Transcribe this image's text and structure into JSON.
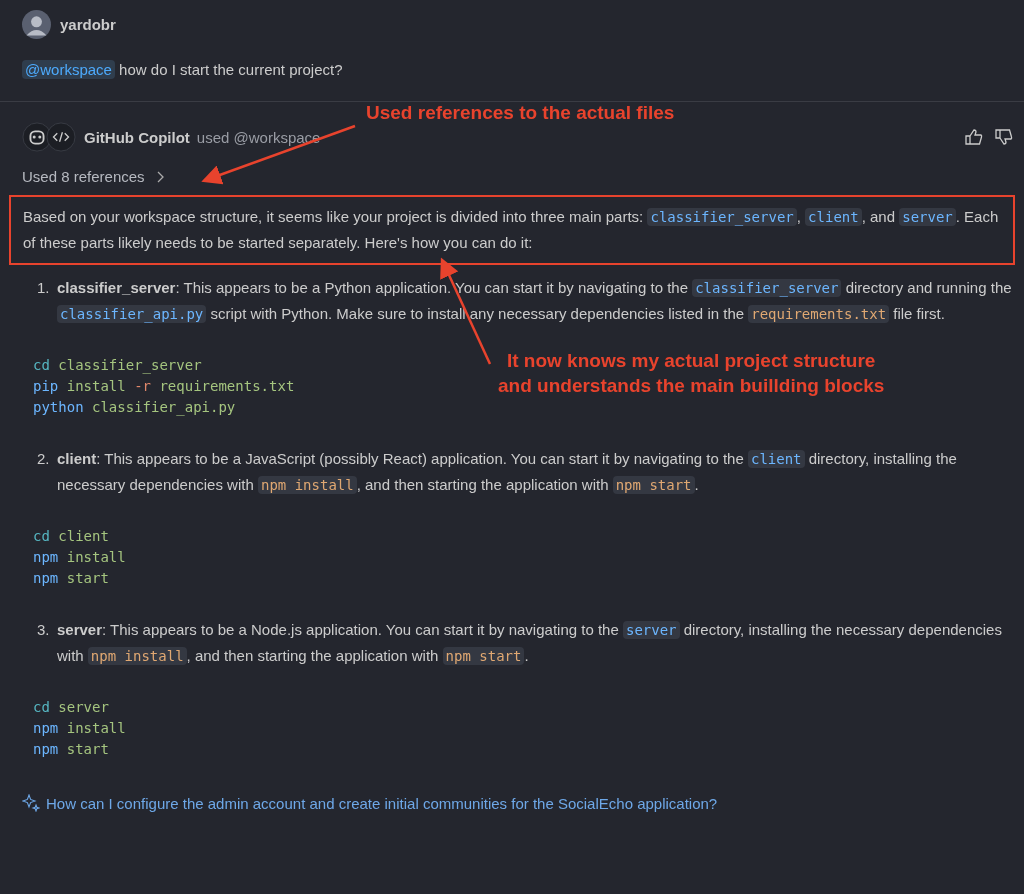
{
  "user": {
    "name": "yardobr"
  },
  "prompt": {
    "mention": "@workspace",
    "text": "how do I start the current project?"
  },
  "response": {
    "author": "GitHub Copilot",
    "used": "used @workspace",
    "references": "Used 8 references",
    "intro": {
      "highlighted": true,
      "segments": [
        {
          "kind": "text",
          "text": "Based on your workspace structure, it seems like your project is divided into three main parts: "
        },
        {
          "kind": "path",
          "text": "classifier_server"
        },
        {
          "kind": "text",
          "text": ", "
        },
        {
          "kind": "path",
          "text": "client"
        },
        {
          "kind": "text",
          "text": ", and "
        },
        {
          "kind": "path",
          "text": "server"
        },
        {
          "kind": "text",
          "text": ". Each of these parts likely needs to be started separately. Here's how you can do it:"
        }
      ]
    },
    "steps": [
      {
        "number": "1.",
        "segments": [
          {
            "kind": "bold",
            "text": "classifier_server"
          },
          {
            "kind": "text",
            "text": ": This appears to be a Python application. You can start it by navigating to the "
          },
          {
            "kind": "path",
            "text": "classifier_server"
          },
          {
            "kind": "text",
            "text": " directory and running the "
          },
          {
            "kind": "path",
            "text": "classifier_api.py"
          },
          {
            "kind": "text",
            "text": " script with Python. Make sure to install any necessary dependencies listed in the "
          },
          {
            "kind": "literal",
            "text": "requirements.txt"
          },
          {
            "kind": "text",
            "text": " file first."
          }
        ],
        "code": [
          [
            {
              "kind": "builtin",
              "text": "cd"
            },
            {
              "kind": "arg",
              "text": " classifier_server"
            }
          ],
          [
            {
              "kind": "command",
              "text": "pip"
            },
            {
              "kind": "arg",
              "text": " install "
            },
            {
              "kind": "flag",
              "text": "-r"
            },
            {
              "kind": "arg",
              "text": " requirements.txt"
            }
          ],
          [
            {
              "kind": "command",
              "text": "python"
            },
            {
              "kind": "arg",
              "text": " classifier_api.py"
            }
          ]
        ]
      },
      {
        "number": "2.",
        "segments": [
          {
            "kind": "bold",
            "text": "client"
          },
          {
            "kind": "text",
            "text": ": This appears to be a JavaScript (possibly React) application. You can start it by navigating to the "
          },
          {
            "kind": "path",
            "text": "client"
          },
          {
            "kind": "text",
            "text": " directory, installing the necessary dependencies with "
          },
          {
            "kind": "literal",
            "text": "npm install"
          },
          {
            "kind": "text",
            "text": ", and then starting the application with "
          },
          {
            "kind": "literal",
            "text": "npm start"
          },
          {
            "kind": "text",
            "text": "."
          }
        ],
        "code": [
          [
            {
              "kind": "builtin",
              "text": "cd"
            },
            {
              "kind": "arg",
              "text": " client"
            }
          ],
          [
            {
              "kind": "command",
              "text": "npm"
            },
            {
              "kind": "arg",
              "text": " install"
            }
          ],
          [
            {
              "kind": "command",
              "text": "npm"
            },
            {
              "kind": "arg",
              "text": " start"
            }
          ]
        ]
      },
      {
        "number": "3.",
        "segments": [
          {
            "kind": "bold",
            "text": "server"
          },
          {
            "kind": "text",
            "text": ": This appears to be a Node.js application. You can start it by navigating to the "
          },
          {
            "kind": "path",
            "text": "server"
          },
          {
            "kind": "text",
            "text": " directory, installing the necessary dependencies with "
          },
          {
            "kind": "literal",
            "text": "npm install"
          },
          {
            "kind": "text",
            "text": ", and then starting the application with "
          },
          {
            "kind": "literal",
            "text": "npm start"
          },
          {
            "kind": "text",
            "text": "."
          }
        ],
        "code": [
          [
            {
              "kind": "builtin",
              "text": "cd"
            },
            {
              "kind": "arg",
              "text": " server"
            }
          ],
          [
            {
              "kind": "command",
              "text": "npm"
            },
            {
              "kind": "arg",
              "text": " install"
            }
          ],
          [
            {
              "kind": "command",
              "text": "npm"
            },
            {
              "kind": "arg",
              "text": " start"
            }
          ]
        ]
      }
    ]
  },
  "suggestion": "How can I configure the admin account and create initial communities for the SocialEcho application?",
  "annotations": [
    {
      "lines": [
        "Used references to the actual files"
      ]
    },
    {
      "lines": [
        "It now knows my actual project structure",
        "and understands the main buillding blocks"
      ]
    }
  ]
}
